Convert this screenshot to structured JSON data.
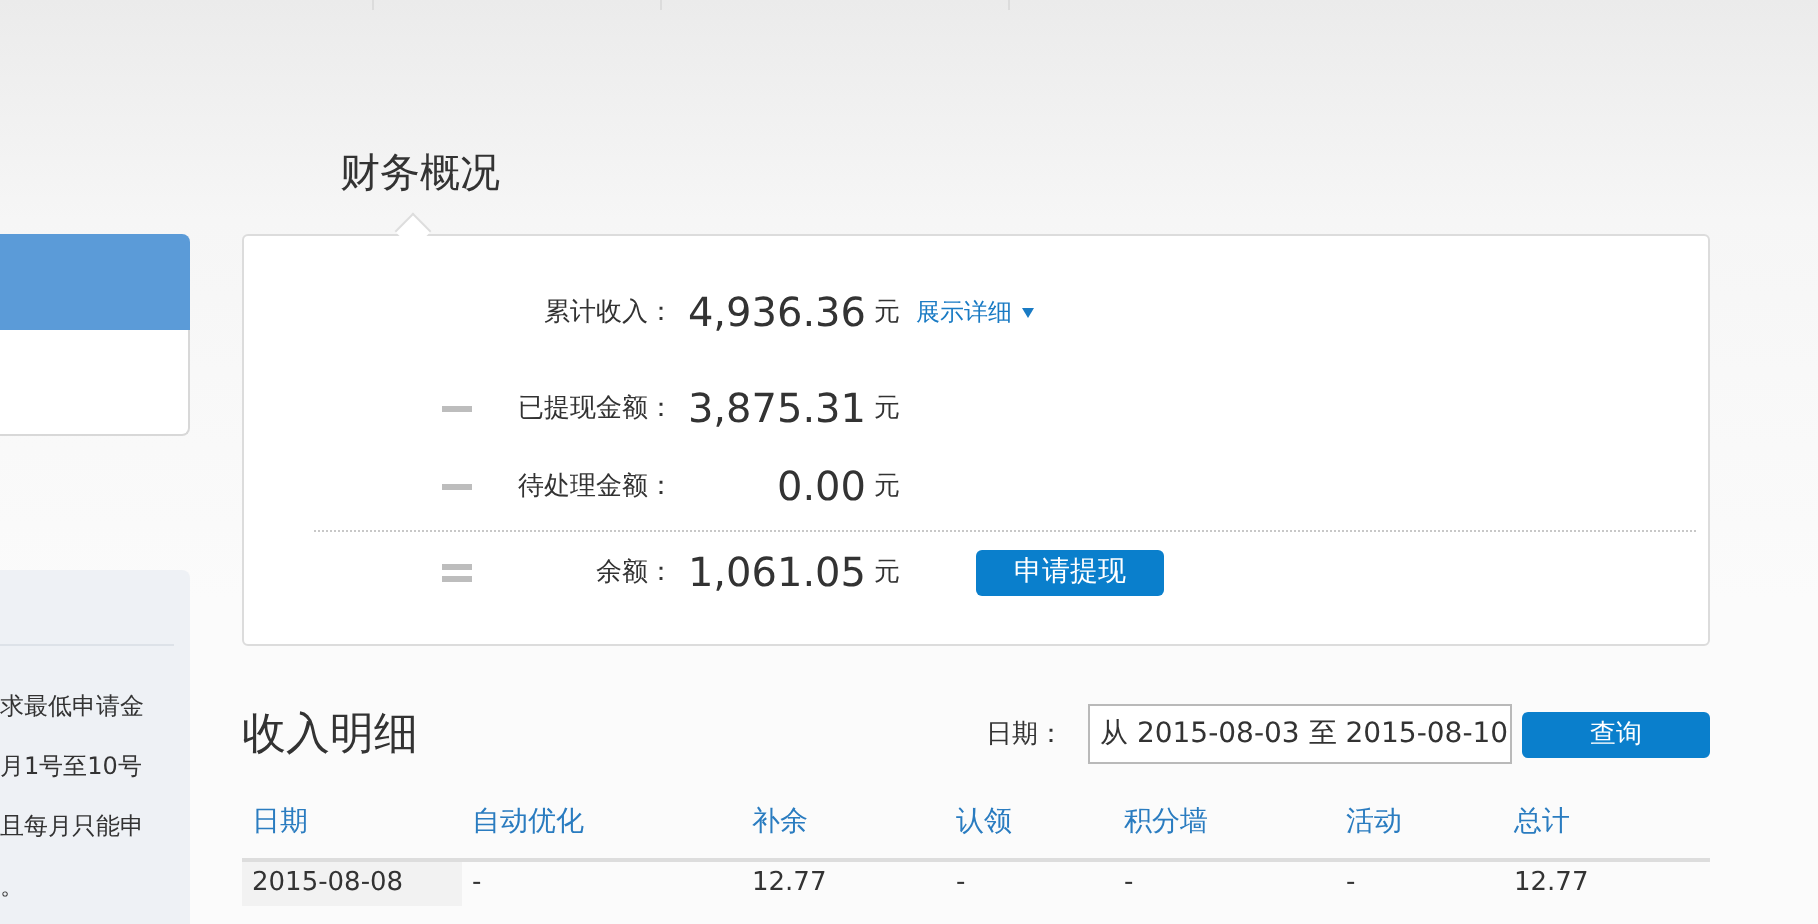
{
  "sidebar": {
    "notes": [
      "求最低申请金",
      "月1号至10号",
      "且每月只能申",
      "。"
    ]
  },
  "summary": {
    "title": "财务概况",
    "rows": [
      {
        "kind": "total",
        "label": "累计收入：",
        "amount": "4,936.36",
        "unit": "元",
        "link": "展示详细"
      },
      {
        "kind": "minus",
        "label": "已提现金额：",
        "amount": "3,875.31",
        "unit": "元"
      },
      {
        "kind": "minus",
        "label": "待处理金额：",
        "amount": "0.00",
        "unit": "元"
      },
      {
        "kind": "equals",
        "label": "余额：",
        "amount": "1,061.05",
        "unit": "元",
        "button": "申请提现"
      }
    ]
  },
  "income": {
    "title": "收入明细",
    "date_label": "日期：",
    "date_value": "从 2015-08-03 至 2015-08-10",
    "query_button": "查询",
    "columns": [
      "日期",
      "自动优化",
      "补余",
      "认领",
      "积分墙",
      "活动",
      "总计"
    ],
    "rows": [
      [
        "2015-08-08",
        "-",
        "12.77",
        "-",
        "-",
        "-",
        "12.77"
      ]
    ]
  }
}
